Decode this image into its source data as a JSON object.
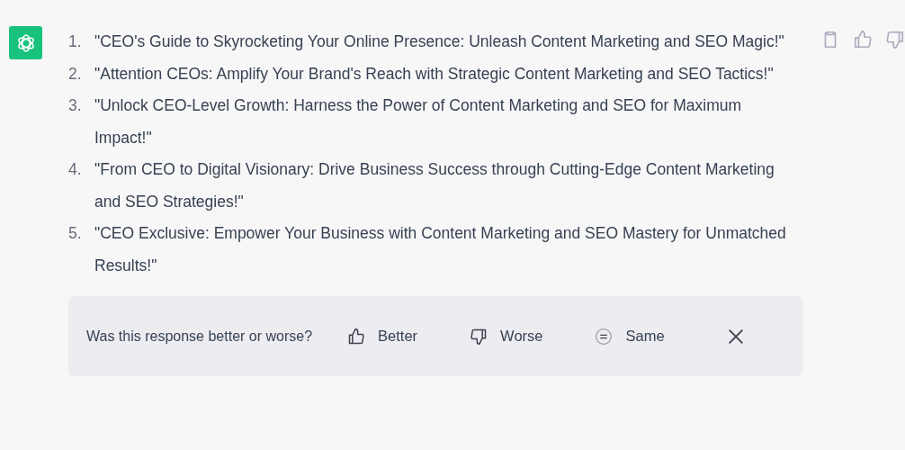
{
  "items": [
    {
      "number": "1.",
      "text": "\"CEO's Guide to Skyrocketing Your Online Presence: Unleash Content Marketing and SEO Magic!\""
    },
    {
      "number": "2.",
      "text": "\"Attention CEOs: Amplify Your Brand's Reach with Strategic Content Marketing and SEO Tactics!\""
    },
    {
      "number": "3.",
      "text": "\"Unlock CEO-Level Growth: Harness the Power of Content Marketing and SEO for Maximum Impact!\""
    },
    {
      "number": "4.",
      "text": "\"From CEO to Digital Visionary: Drive Business Success through Cutting-Edge Content Marketing and SEO Strategies!\""
    },
    {
      "number": "5.",
      "text": "\"CEO Exclusive: Empower Your Business with Content Marketing and SEO Mastery for Unmatched Results!\""
    }
  ],
  "feedback": {
    "question": "Was this response better or worse?",
    "options": [
      {
        "kind": "better",
        "label": "Better"
      },
      {
        "kind": "worse",
        "label": "Worse"
      },
      {
        "kind": "same",
        "label": "Same"
      }
    ]
  }
}
